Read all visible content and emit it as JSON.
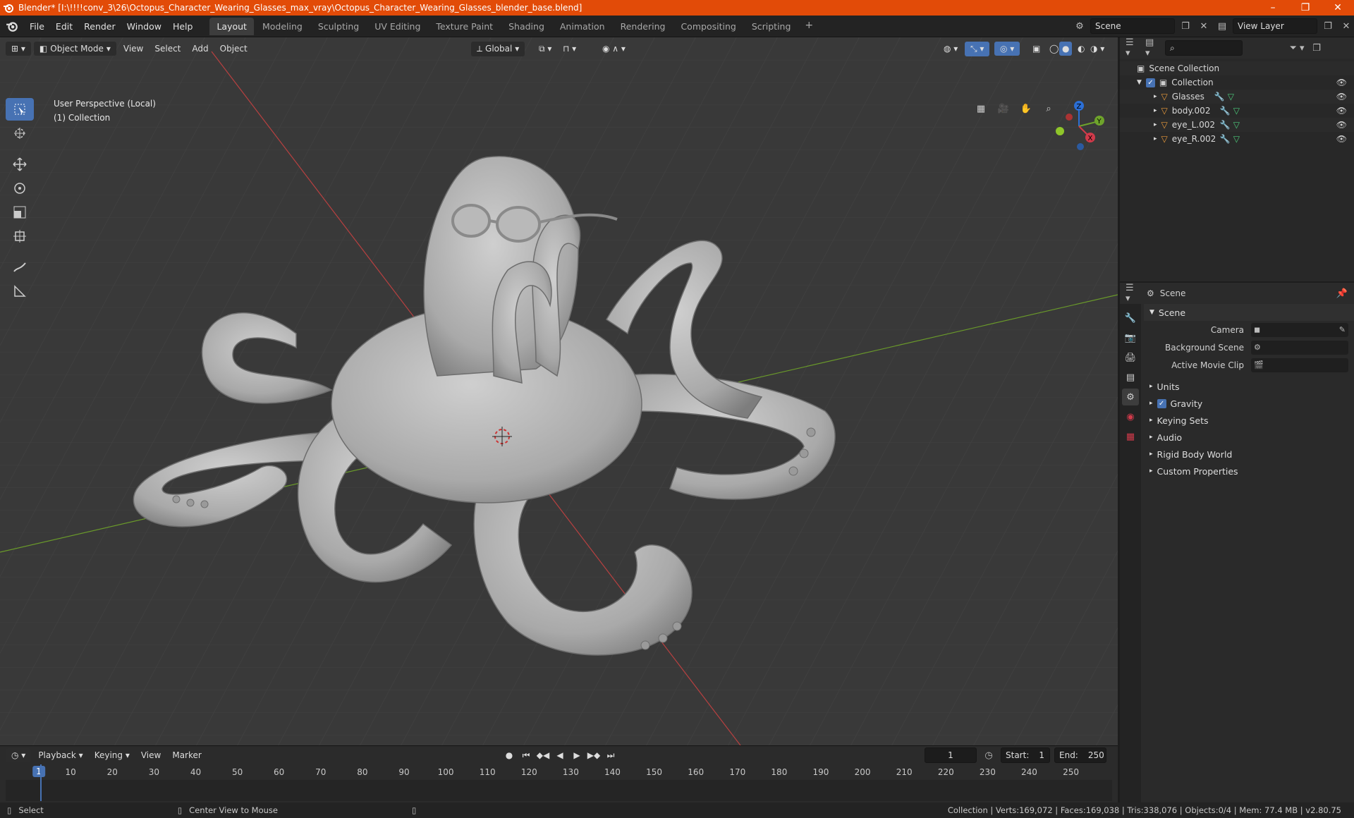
{
  "window": {
    "title": "Blender* [I:\\!!!!conv_3\\26\\Octopus_Character_Wearing_Glasses_max_vray\\Octopus_Character_Wearing_Glasses_blender_base.blend]",
    "controls": [
      "–",
      "❐",
      "✕"
    ]
  },
  "menu": [
    "File",
    "Edit",
    "Render",
    "Window",
    "Help"
  ],
  "workspaces": [
    {
      "label": "Layout",
      "active": true
    },
    {
      "label": "Modeling"
    },
    {
      "label": "Sculpting"
    },
    {
      "label": "UV Editing"
    },
    {
      "label": "Texture Paint"
    },
    {
      "label": "Shading"
    },
    {
      "label": "Animation"
    },
    {
      "label": "Rendering"
    },
    {
      "label": "Compositing"
    },
    {
      "label": "Scripting"
    }
  ],
  "topright": {
    "scene": "Scene",
    "view_layer": "View Layer"
  },
  "viewport": {
    "mode": "Object Mode",
    "menus": [
      "View",
      "Select",
      "Add",
      "Object"
    ],
    "orientation": "Global",
    "info_line1": "User Perspective (Local)",
    "info_line2": "(1) Collection",
    "gizmo": {
      "x": "X",
      "y": "Y",
      "z": "Z"
    }
  },
  "outliner": {
    "root": "Scene Collection",
    "collection": "Collection",
    "objects": [
      "Glasses",
      "body.002",
      "eye_L.002",
      "eye_R.002"
    ]
  },
  "properties": {
    "header": "Scene",
    "panel": "Scene",
    "rows": [
      {
        "label": "Camera"
      },
      {
        "label": "Background Scene"
      },
      {
        "label": "Active Movie Clip"
      }
    ],
    "sections": [
      "Units",
      "Gravity",
      "Keying Sets",
      "Audio",
      "Rigid Body World",
      "Custom Properties"
    ]
  },
  "timeline": {
    "menus": [
      "Playback",
      "Keying",
      "View",
      "Marker"
    ],
    "current_frame": "1",
    "start_label": "Start:",
    "start": "1",
    "end_label": "End:",
    "end": "250",
    "ticks": [
      "1",
      "10",
      "20",
      "30",
      "40",
      "50",
      "60",
      "70",
      "80",
      "90",
      "100",
      "110",
      "120",
      "130",
      "140",
      "150",
      "160",
      "170",
      "180",
      "190",
      "200",
      "210",
      "220",
      "230",
      "240",
      "250"
    ]
  },
  "status": {
    "select": "Select",
    "center": "Center View to Mouse",
    "stats": "Collection | Verts:169,072 | Faces:169,038 | Tris:338,076 | Objects:0/4 | Mem: 77.4 MB | v2.80.75"
  },
  "colors": {
    "accent": "#4772b3",
    "titlebar": "#e24b08",
    "x_axis": "#b84040",
    "y_axis": "#6a9a2a"
  }
}
